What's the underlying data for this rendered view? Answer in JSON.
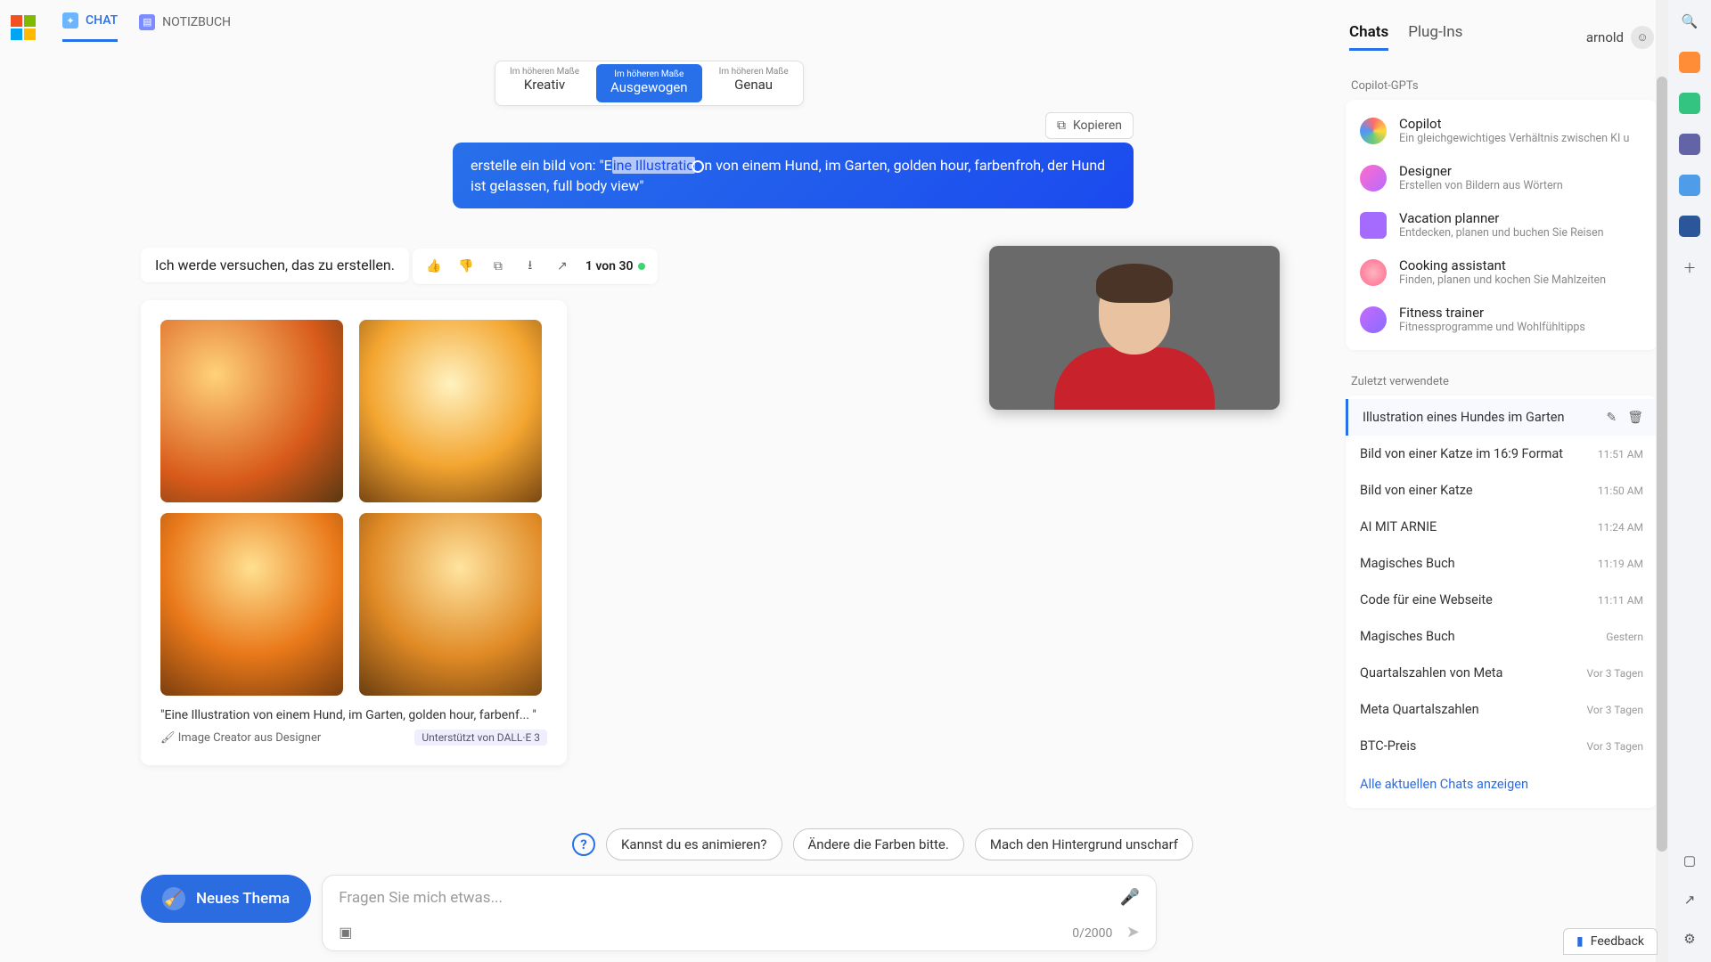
{
  "top": {
    "chat_tab": "CHAT",
    "notebook_tab": "NOTIZBUCH"
  },
  "styles": {
    "prefix": "Im höheren Maße",
    "creative": "Kreativ",
    "balanced": "Ausgewogen",
    "precise": "Genau"
  },
  "chat": {
    "copy": "Kopieren",
    "user_prefix": "erstelle ein bild von: \"E",
    "user_sel": "ine Illustratio",
    "user_rest": "n von einem Hund, im Garten, golden hour, farbenfroh, der Hund ist gelassen, full body view\"",
    "bot_reply": "Ich werde versuchen, das zu erstellen.",
    "counter": "1 von 30",
    "img_caption": "\"Eine Illustration von einem Hund, im Garten, golden hour, farbenf... \"",
    "img_source": "🖌 Image Creator aus Designer",
    "dalle": "Unterstützt von DALL·E 3"
  },
  "chips": {
    "a": "Kannst du es animieren?",
    "b": "Ändere die Farben bitte.",
    "c": "Mach den Hintergrund unscharf"
  },
  "composer": {
    "new_topic": "Neues Thema",
    "placeholder": "Fragen Sie mich etwas...",
    "counter": "0/2000"
  },
  "sidebar": {
    "tabs": {
      "chats": "Chats",
      "plugins": "Plug-Ins"
    },
    "user": "arnold",
    "gpts_label": "Copilot-GPTs",
    "gpts": [
      {
        "title": "Copilot",
        "sub": "Ein gleichgewichtiges Verhältnis zwischen KI u"
      },
      {
        "title": "Designer",
        "sub": "Erstellen von Bildern aus Wörtern"
      },
      {
        "title": "Vacation planner",
        "sub": "Entdecken, planen und buchen Sie Reisen"
      },
      {
        "title": "Cooking assistant",
        "sub": "Finden, planen und kochen Sie Mahlzeiten"
      },
      {
        "title": "Fitness trainer",
        "sub": "Fitnessprogramme und Wohlfühltipps"
      }
    ],
    "recent_label": "Zuletzt verwendete",
    "recent": [
      {
        "title": "Illustration eines Hundes im Garten",
        "time": ""
      },
      {
        "title": "Bild von einer Katze im 16:9 Format",
        "time": "11:51 AM"
      },
      {
        "title": "Bild von einer Katze",
        "time": "11:50 AM"
      },
      {
        "title": "AI MIT ARNIE",
        "time": "11:24 AM"
      },
      {
        "title": "Magisches Buch",
        "time": "11:19 AM"
      },
      {
        "title": "Code für eine Webseite",
        "time": "11:11 AM"
      },
      {
        "title": "Magisches Buch",
        "time": "Gestern"
      },
      {
        "title": "Quartalszahlen von Meta",
        "time": "Vor 3 Tagen"
      },
      {
        "title": "Meta Quartalszahlen",
        "time": "Vor 3 Tagen"
      },
      {
        "title": "BTC-Preis",
        "time": "Vor 3 Tagen"
      }
    ],
    "all_link": "Alle aktuellen Chats anzeigen"
  },
  "feedback": "Feedback"
}
